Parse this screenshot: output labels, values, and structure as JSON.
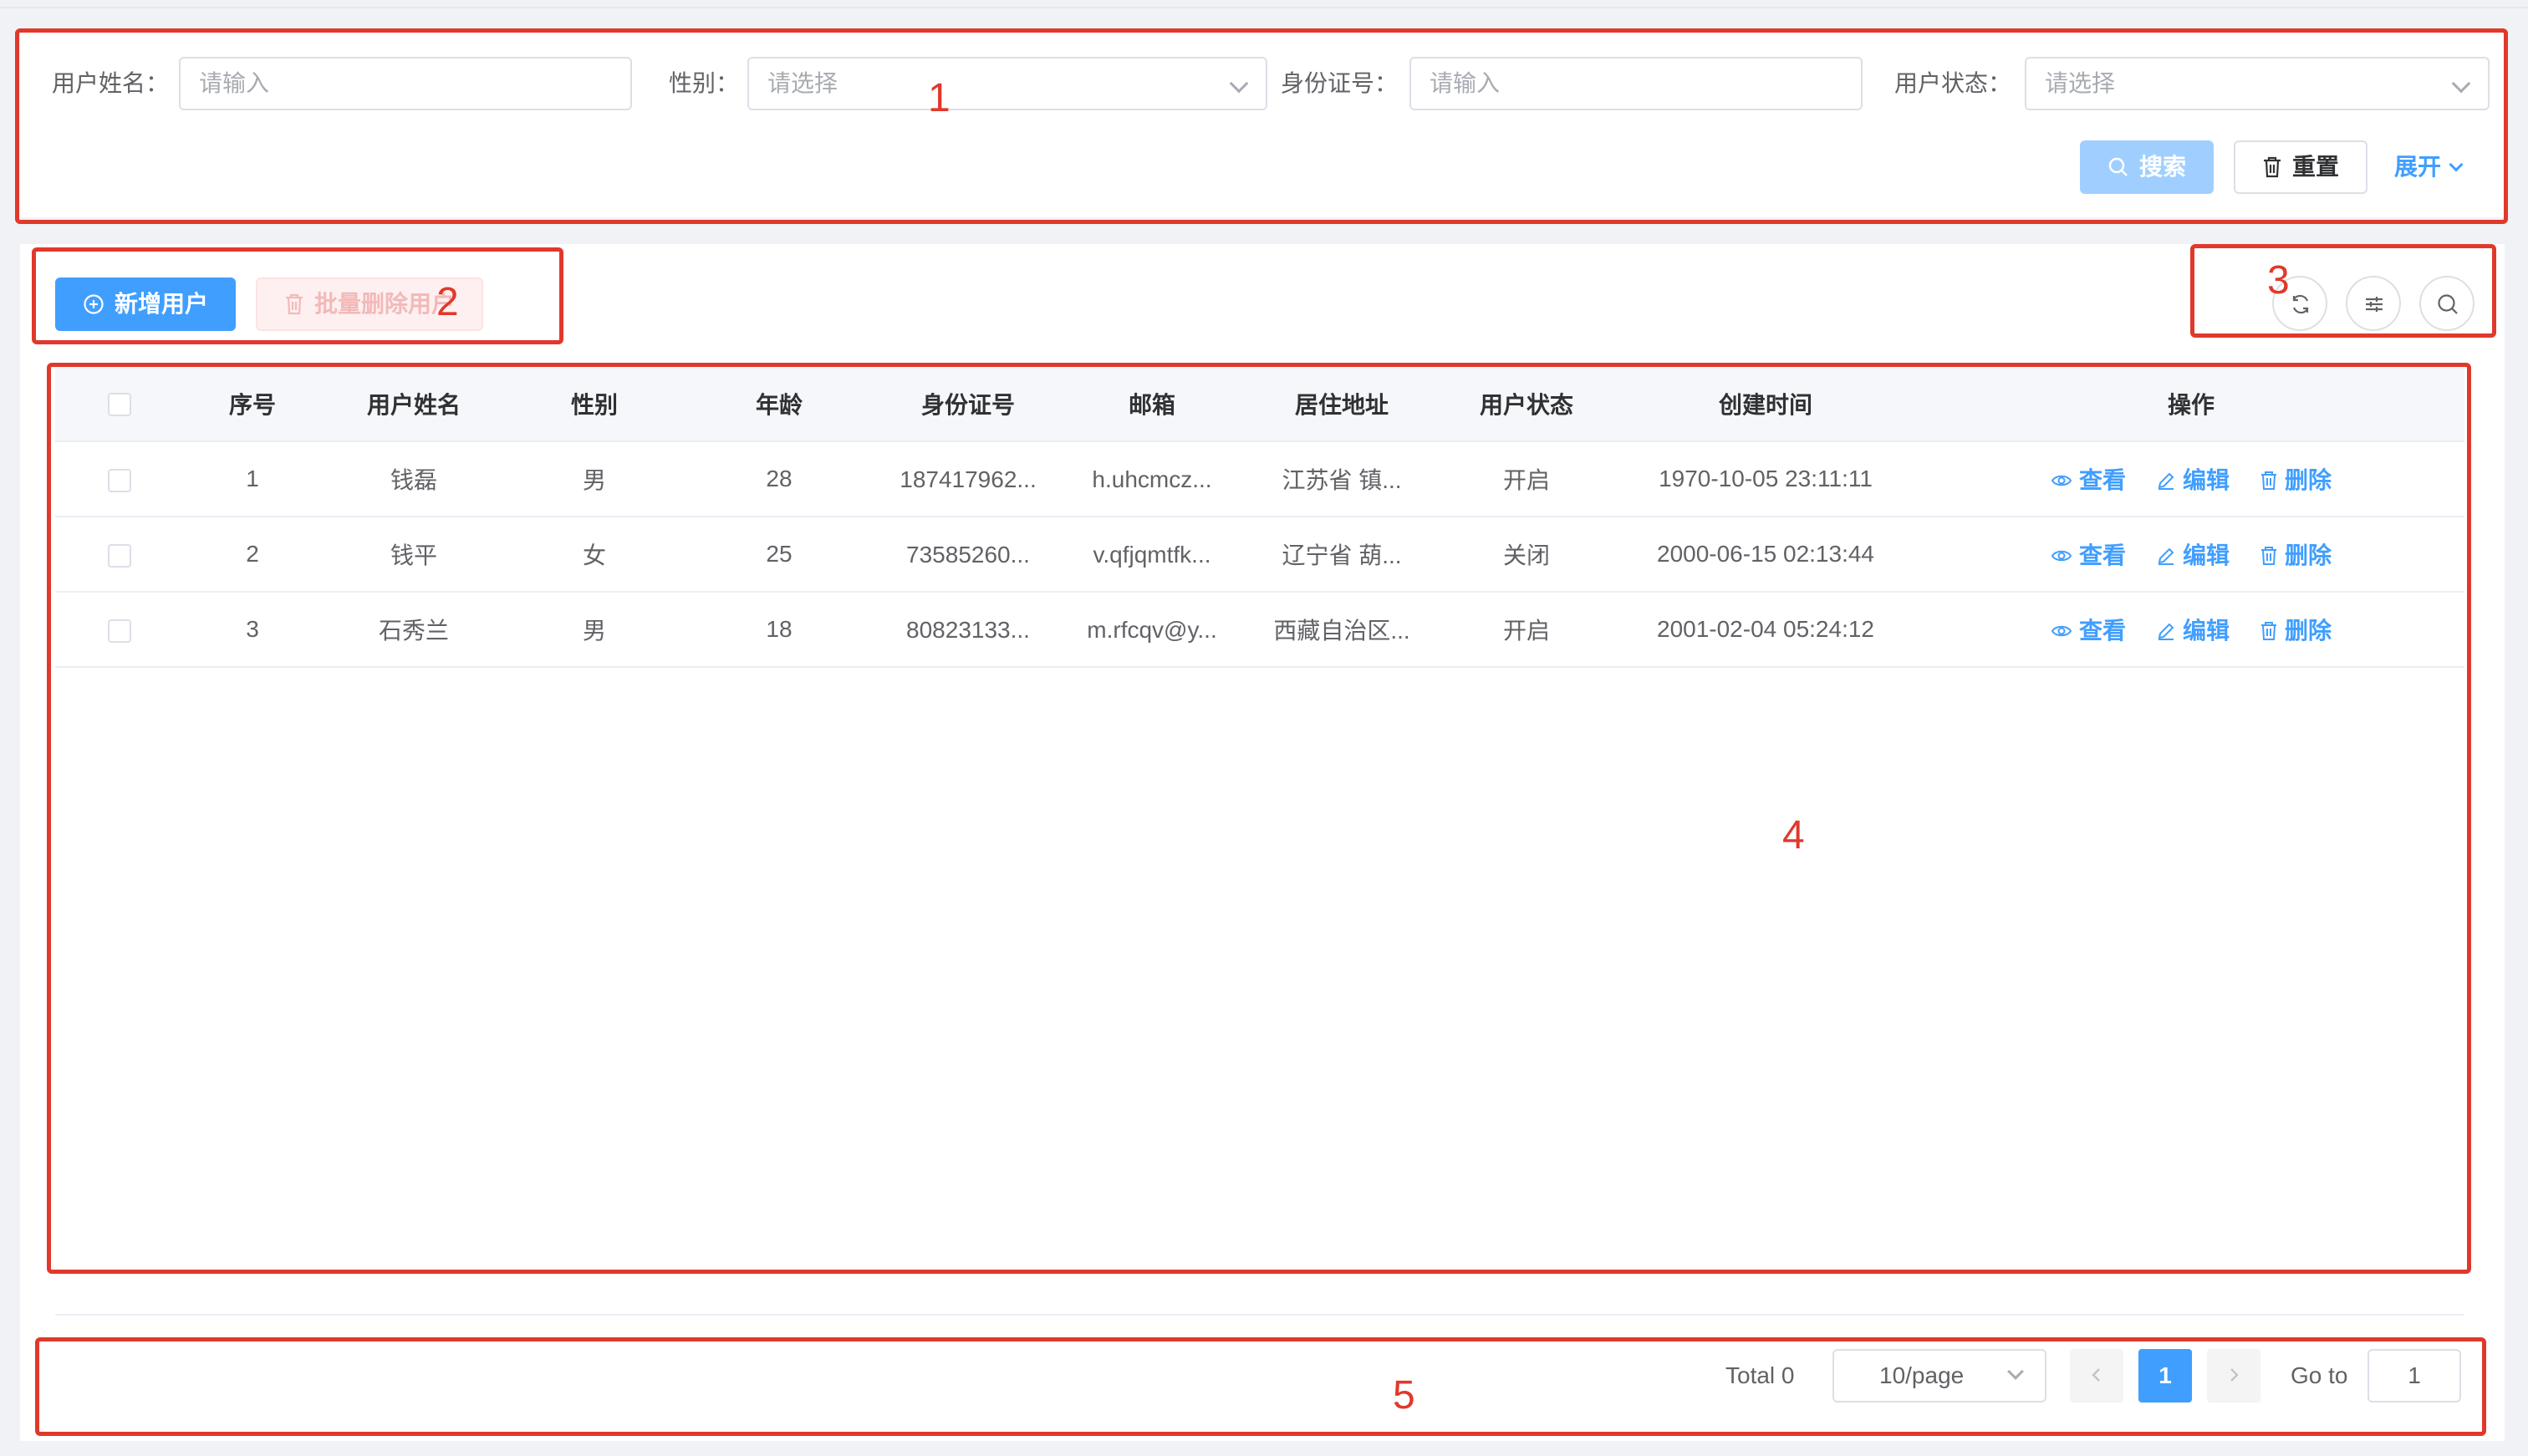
{
  "search": {
    "username_label": "用户姓名：",
    "username_placeholder": "请输入",
    "gender_label": "性别：",
    "gender_placeholder": "请选择",
    "idcard_label": "身份证号：",
    "idcard_placeholder": "请输入",
    "status_label": "用户状态：",
    "status_placeholder": "请选择",
    "search_button": "搜索",
    "reset_button": "重置",
    "expand_button": "展开"
  },
  "toolbar": {
    "add_button": "新增用户",
    "batch_delete_button": "批量删除用户",
    "icons": [
      "refresh-icon",
      "column-settings-icon",
      "search-icon"
    ]
  },
  "table": {
    "columns": [
      "序号",
      "用户姓名",
      "性别",
      "年龄",
      "身份证号",
      "邮箱",
      "居住地址",
      "用户状态",
      "创建时间",
      "操作"
    ],
    "rows": [
      {
        "index": "1",
        "name": "钱磊",
        "gender": "男",
        "age": "28",
        "idcard": "187417962...",
        "email": "h.uhcmcz...",
        "address": "江苏省 镇...",
        "status": "开启",
        "created": "1970-10-05 23:11:11"
      },
      {
        "index": "2",
        "name": "钱平",
        "gender": "女",
        "age": "25",
        "idcard": "73585260...",
        "email": "v.qfjqmtfk...",
        "address": "辽宁省 葫...",
        "status": "关闭",
        "created": "2000-06-15 02:13:44"
      },
      {
        "index": "3",
        "name": "石秀兰",
        "gender": "男",
        "age": "18",
        "idcard": "80823133...",
        "email": "m.rfcqv@y...",
        "address": "西藏自治区...",
        "status": "开启",
        "created": "2001-02-04 05:24:12"
      }
    ],
    "actions": {
      "view": "查看",
      "edit": "编辑",
      "delete": "删除"
    }
  },
  "pagination": {
    "total_text": "Total 0",
    "page_size": "10/page",
    "current_page": "1",
    "goto_label": "Go to",
    "goto_value": "1"
  },
  "annotations": [
    "1",
    "2",
    "3",
    "4",
    "5"
  ],
  "colors": {
    "primary": "#409eff",
    "primary_light": "#a0cfff",
    "danger_light": "#fef0f0",
    "annotation": "#e0392b",
    "background": "#f0f2f5"
  }
}
